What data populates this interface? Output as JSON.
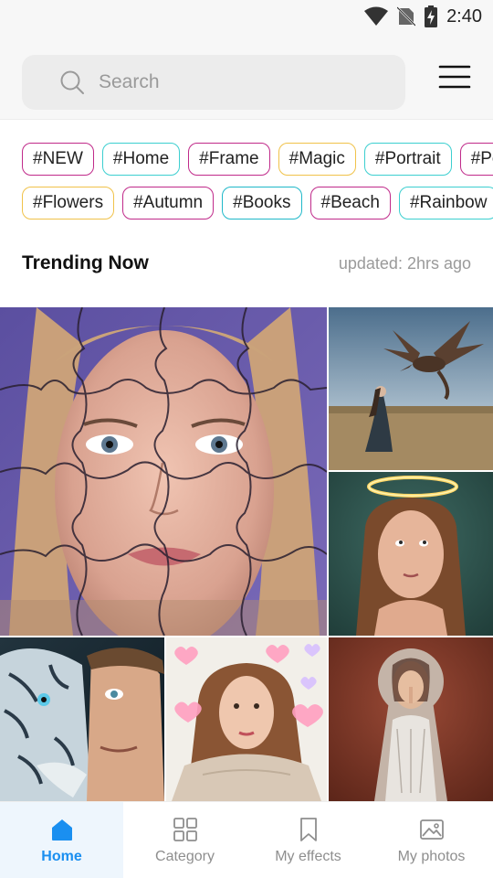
{
  "status_bar": {
    "time": "2:40"
  },
  "search": {
    "placeholder": "Search"
  },
  "tags": {
    "row1": [
      {
        "label": "#NEW",
        "color": "#c02a8a"
      },
      {
        "label": "#Home",
        "color": "#3ccfd0"
      },
      {
        "label": "#Frame",
        "color": "#c02a8a"
      },
      {
        "label": "#Magic",
        "color": "#f0c24a"
      },
      {
        "label": "#Portrait",
        "color": "#3ccfd0"
      },
      {
        "label": "#Pets",
        "color": "#c02a8a"
      }
    ],
    "row2": [
      {
        "label": "#Flowers",
        "color": "#f0c24a"
      },
      {
        "label": "#Autumn",
        "color": "#c02a8a"
      },
      {
        "label": "#Books",
        "color": "#1fb8c9"
      },
      {
        "label": "#Beach",
        "color": "#c02a8a"
      },
      {
        "label": "#Rainbow",
        "color": "#3ccfd0"
      }
    ]
  },
  "trending": {
    "title": "Trending Now",
    "updated": "updated: 2hrs ago"
  },
  "grid": {
    "tiles": [
      {
        "name": "puzzle-portrait-effect"
      },
      {
        "name": "dragon-field-effect"
      },
      {
        "name": "angel-halo-effect"
      },
      {
        "name": "tiger-face-effect"
      },
      {
        "name": "hearts-portrait-effect"
      },
      {
        "name": "keyhole-portrait-effect"
      }
    ]
  },
  "nav": {
    "items": [
      {
        "label": "Home",
        "icon": "home-icon",
        "active": true
      },
      {
        "label": "Category",
        "icon": "category-grid-icon",
        "active": false
      },
      {
        "label": "My effects",
        "icon": "bookmark-icon",
        "active": false
      },
      {
        "label": "My photos",
        "icon": "image-icon",
        "active": false
      }
    ]
  },
  "colors": {
    "accent": "#1a8ff0",
    "tag_magenta": "#c02a8a",
    "tag_cyan": "#3ccfd0",
    "tag_yellow": "#f0c24a"
  }
}
